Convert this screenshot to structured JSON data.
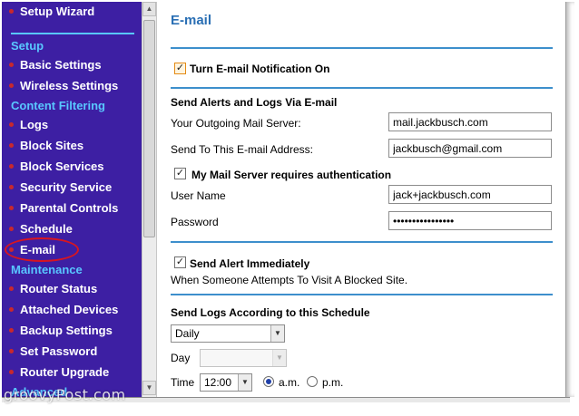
{
  "sidebar": {
    "top_item": "Setup Wizard",
    "sections": [
      {
        "title": "Setup",
        "items": [
          "Basic Settings",
          "Wireless Settings"
        ]
      },
      {
        "title": "Content Filtering",
        "items": [
          "Logs",
          "Block Sites",
          "Block Services",
          "Security Service",
          "Parental Controls",
          "Schedule",
          "E-mail"
        ]
      },
      {
        "title": "Maintenance",
        "items": [
          "Router Status",
          "Attached Devices",
          "Backup Settings",
          "Set Password",
          "Router Upgrade"
        ]
      },
      {
        "title": "Advanced",
        "items": []
      }
    ],
    "selected_item": "E-mail",
    "colors": {
      "background": "#3d1fa3",
      "section": "#59c7ff",
      "bullet": "#c8282d",
      "highlight": "#d8151f"
    }
  },
  "page": {
    "title": "E-mail",
    "turn_on_label": "Turn E-mail Notification On",
    "turn_on_checked": true,
    "alerts_section_title": "Send Alerts and Logs Via E-mail",
    "outgoing_server_label": "Your Outgoing Mail Server:",
    "outgoing_server_value": "mail.jackbusch.com",
    "send_to_label": "Send To This E-mail Address:",
    "send_to_value": "jackbusch@gmail.com",
    "auth_label": "My Mail Server requires authentication",
    "auth_checked": true,
    "username_label": "User Name",
    "username_value": "jack+jackbusch.com",
    "password_label": "Password",
    "password_value": "••••••••••••••••",
    "alert_immediately_label": "Send Alert Immediately",
    "alert_immediately_checked": true,
    "alert_description": "When Someone Attempts To Visit A Blocked Site.",
    "schedule_section_title": "Send Logs According to this Schedule",
    "schedule_value": "Daily",
    "day_label": "Day",
    "day_value": "",
    "time_label": "Time",
    "time_value": "12:00",
    "am_label": "a.m.",
    "pm_label": "p.m.",
    "am_selected": true,
    "accent_color": "#2a6fb4"
  },
  "watermark": "groovyPost.com"
}
